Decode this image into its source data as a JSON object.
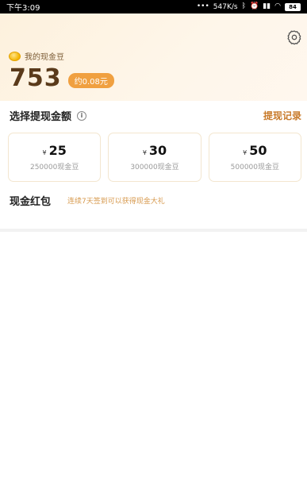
{
  "status_bar": {
    "time": "下午3:09",
    "speed": "547K/s",
    "battery": "84"
  },
  "header": {
    "bean_label": "我的现金豆",
    "balance": "753",
    "approx_value": "约0.08元"
  },
  "withdraw": {
    "title": "选择提现金额",
    "record_link": "提现记录",
    "options": [
      {
        "currency": "¥",
        "amount": "25",
        "beans": "250000现金豆"
      },
      {
        "currency": "¥",
        "amount": "30",
        "beans": "300000现金豆"
      },
      {
        "currency": "¥",
        "amount": "50",
        "beans": "500000现金豆"
      }
    ]
  },
  "red_packet": {
    "title": "现金红包",
    "note": "连续7天签到可以获得现金大礼"
  },
  "colors": {
    "accent": "#f0a040",
    "link": "#c87a2a",
    "header_bg": "#fdf1dd"
  }
}
